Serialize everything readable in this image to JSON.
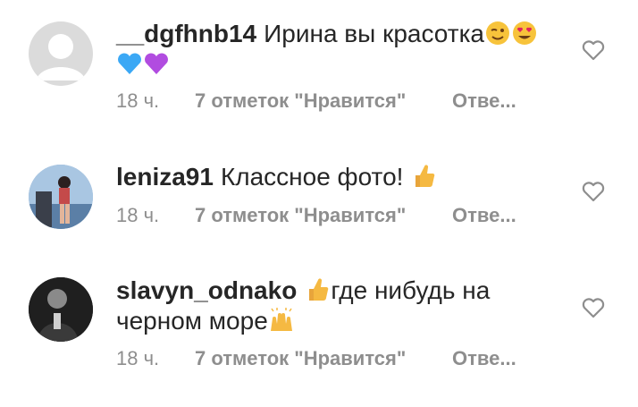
{
  "comments": [
    {
      "username": "__dgfhnb14",
      "text": "Ирина вы красотка",
      "emojis_inline": [
        "winking-face-emoji",
        "heart-eyes-emoji"
      ],
      "emojis_next_line": [
        "blue-heart-emoji",
        "purple-heart-emoji"
      ],
      "time": "18 ч.",
      "likes": "7 отметок \"Нравится\"",
      "reply": "Отве..."
    },
    {
      "username": "leniza91",
      "text": "Классное фото!",
      "emojis_inline": [
        "thumbs-up-emoji"
      ],
      "time": "18 ч.",
      "likes": "7 отметок \"Нравится\"",
      "reply": "Отве..."
    },
    {
      "username": "slavyn_odnako",
      "text_part1": "где нибудь на",
      "text_part2": "черном море",
      "emojis_inline": [
        "thumbs-up-emoji",
        "raising-hands-emoji"
      ],
      "time": "18 ч.",
      "likes": "7 отметок \"Нравится\"",
      "reply": "Отве..."
    }
  ],
  "colors": {
    "text": "#262626",
    "meta": "#8e8e8e",
    "heart_outline": "#8e8e8e",
    "avatar_placeholder": "#dbdbdb"
  }
}
